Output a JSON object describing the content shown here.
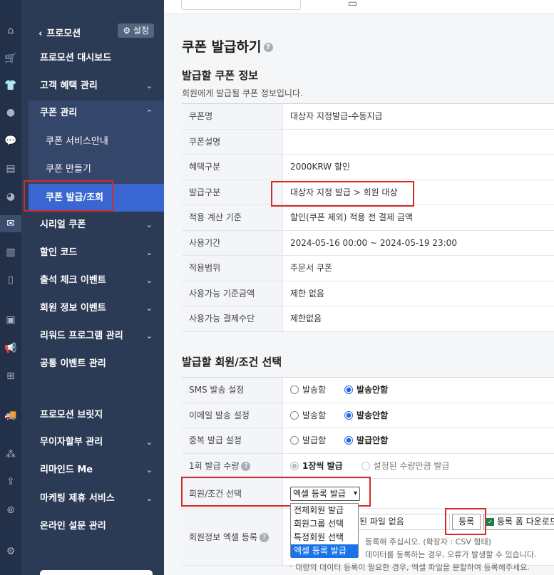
{
  "nav": {
    "back_label": "프로모션",
    "settings_label": "설정",
    "items": [
      {
        "label": "프로모션 대시보드"
      },
      {
        "label": "고객 혜택 관리"
      },
      {
        "label": "쿠폰 관리"
      },
      {
        "label": "쿠폰 서비스안내"
      },
      {
        "label": "쿠폰 만들기"
      },
      {
        "label": "쿠폰 발급/조회"
      },
      {
        "label": "시리얼 쿠폰"
      },
      {
        "label": "할인 코드"
      },
      {
        "label": "출석 체크 이벤트"
      },
      {
        "label": "회원 정보 이벤트"
      },
      {
        "label": "리워드 프로그램 관리"
      },
      {
        "label": "공통 이벤트 관리"
      },
      {
        "label": "프로모션 브릿지"
      },
      {
        "label": "무이자할부 관리"
      },
      {
        "label": "리마인드 Me"
      },
      {
        "label": "마케팅 제휴 서비스"
      },
      {
        "label": "온라인 설문 관리"
      }
    ]
  },
  "page": {
    "title": "쿠폰 발급하기",
    "coupon_section_title": "발급할 쿠폰 정보",
    "coupon_section_desc": "회원에게 발급될 쿠폰 정보입니다.",
    "coupon_rows": [
      {
        "label": "쿠폰명",
        "value": "대상자 지정발급-수동지급"
      },
      {
        "label": "쿠폰설명",
        "value": ""
      },
      {
        "label": "혜택구분",
        "value": "2000KRW 할인"
      },
      {
        "label": "발급구분",
        "value": "대상자 지정 발급 > 회원 대상"
      },
      {
        "label": "적용 계산 기준",
        "value": "할인(쿠폰 제외) 적용 전 결제 금액"
      },
      {
        "label": "사용기간",
        "value": "2024-05-16 00:00 ~ 2024-05-19 23:00"
      },
      {
        "label": "적용범위",
        "value": "주문서 쿠폰"
      },
      {
        "label": "사용가능 기준금액",
        "value": "제한 없음"
      },
      {
        "label": "사용가능 결제수단",
        "value": "제한없음"
      }
    ],
    "member_section_title": "발급할 회원/조건 선택",
    "sms": {
      "label": "SMS 발송 설정",
      "opt1": "발송함",
      "opt2": "발송안함"
    },
    "email": {
      "label": "이메일 발송 설정",
      "opt1": "발송함",
      "opt2": "발송안함"
    },
    "dup": {
      "label": "중복 발급 설정",
      "opt1": "발급함",
      "opt2": "발급안함"
    },
    "qty": {
      "label": "1회 발급 수량",
      "opt1": "1장씩 발급",
      "opt2": "설정된 수량만큼 발급"
    },
    "condition": {
      "label": "회원/조건 선택",
      "selected": "엑셀 등록 발급",
      "options": [
        "전체회원 발급",
        "회원그룹 선택",
        "특정회원 선택",
        "엑셀 등록 발급"
      ]
    },
    "excel": {
      "label": "회원정보 엑셀 등록",
      "file_text": "된 파일 없음",
      "register_label": "등록",
      "form_download_label": "등록 폼 다운로드",
      "note1": "등록해 주십시오. (확장자 : CSV 형태)",
      "note2": "데이터를 등록하는 경우, 오류가 발생할 수 있습니다.",
      "note3": "대량의 데이터 등록이 필요한 경우, 엑셀 파일을 분할하여 등록해주세요."
    }
  }
}
